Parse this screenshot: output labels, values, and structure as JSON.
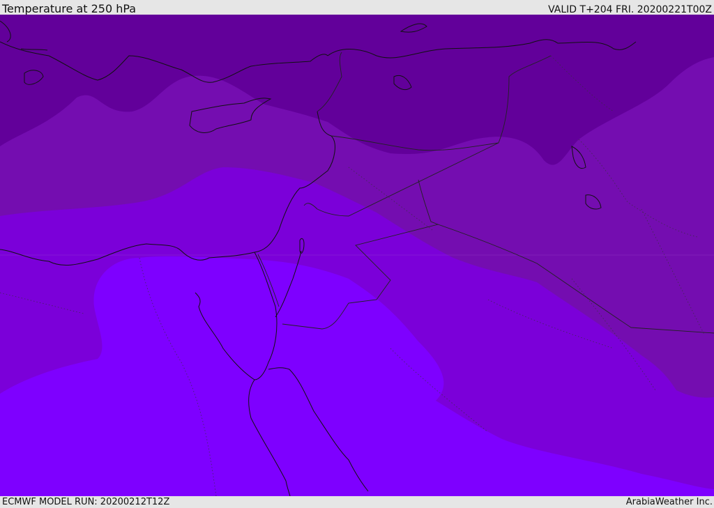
{
  "header": {
    "title": "Temperature at 250 hPa",
    "valid": "VALID T+204 FRI. 20200221T00Z"
  },
  "footer": {
    "model_run": "ECMWF MODEL RUN: 20200212T12Z",
    "credit": "ArabiaWeather Inc."
  },
  "map": {
    "field": "temperature-250hPa",
    "region": "Eastern Mediterranean / Middle East",
    "colors": {
      "band_coldest": "#62009a",
      "band_cold": "#740db0",
      "band_mid": "#7b00d9",
      "band_warm": "#7e00ff",
      "coastline": "#111111",
      "border": "#222222"
    }
  }
}
